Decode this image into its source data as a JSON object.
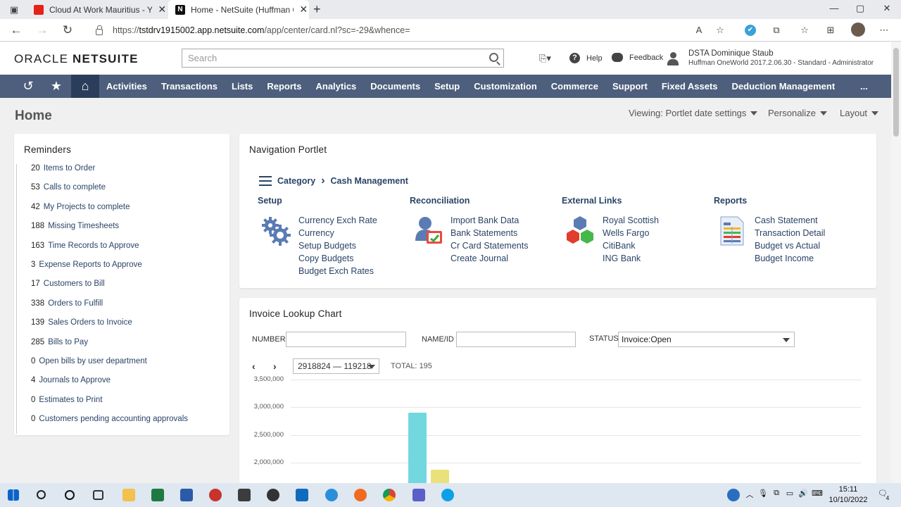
{
  "browser": {
    "tabs": [
      {
        "title": "Cloud At Work Mauritius - YouTube"
      },
      {
        "title": "Home - NetSuite (Huffman OneWorld)"
      }
    ],
    "new_tab": "+",
    "url_prefix": "https://",
    "url_host": "tstdrv1915002.app.netsuite.com",
    "url_path": "/app/center/card.nl?sc=-29&whence="
  },
  "header": {
    "logo_light": "ORACLE ",
    "logo_bold": "NETSUITE",
    "search_placeholder": "Search",
    "help": "Help",
    "feedback": "Feedback",
    "user_name": "DSTA Dominique Staub",
    "user_role": "Huffman OneWorld 2017.2.06.30 - Standard - Administrator"
  },
  "nav": {
    "items": [
      "Activities",
      "Transactions",
      "Lists",
      "Reports",
      "Analytics",
      "Documents",
      "Setup",
      "Customization",
      "Commerce",
      "Support",
      "Fixed Assets",
      "Deduction Management"
    ],
    "more": "..."
  },
  "page": {
    "title": "Home",
    "viewing": "Viewing: Portlet date settings",
    "personalize": "Personalize",
    "layout": "Layout"
  },
  "reminders": {
    "title": "Reminders",
    "items": [
      {
        "count": "20",
        "label": "Items to Order"
      },
      {
        "count": "53",
        "label": "Calls to complete"
      },
      {
        "count": "42",
        "label": "My Projects to complete"
      },
      {
        "count": "188",
        "label": "Missing Timesheets"
      },
      {
        "count": "163",
        "label": "Time Records to Approve"
      },
      {
        "count": "3",
        "label": "Expense Reports to Approve"
      },
      {
        "count": "17",
        "label": "Customers to Bill"
      },
      {
        "count": "338",
        "label": "Orders to Fulfill"
      },
      {
        "count": "139",
        "label": "Sales Orders to Invoice"
      },
      {
        "count": "285",
        "label": "Bills to Pay"
      },
      {
        "count": "0",
        "label": "Open bills by user department"
      },
      {
        "count": "4",
        "label": "Journals to Approve"
      },
      {
        "count": "0",
        "label": "Estimates to Print"
      },
      {
        "count": "0",
        "label": "Customers pending accounting approvals"
      }
    ]
  },
  "navportlet": {
    "title": "Navigation Portlet",
    "crumb_root": "Category",
    "crumb_current": "Cash Management",
    "columns": [
      {
        "title": "Setup",
        "icon": "gears-icon",
        "links": [
          "Currency Exch Rate",
          "Currency",
          "Setup Budgets",
          "Copy Budgets",
          "Budget Exch Rates"
        ]
      },
      {
        "title": "Reconciliation",
        "icon": "reconcile-icon",
        "links": [
          "Import Bank Data",
          "Bank Statements",
          "Cr Card Statements",
          "Create Journal"
        ]
      },
      {
        "title": "External Links",
        "icon": "hexagons-icon",
        "links": [
          "Royal Scottish",
          "Wells Fargo",
          "CitiBank",
          "ING Bank"
        ]
      },
      {
        "title": "Reports",
        "icon": "report-icon",
        "links": [
          "Cash Statement",
          "Transaction Detail",
          "Budget vs Actual",
          "Budget Income"
        ]
      }
    ]
  },
  "invoice": {
    "title": "Invoice Lookup Chart",
    "number_label": "NUMBER",
    "name_label": "NAME/ID",
    "status_label": "STATUS",
    "status_value": "Invoice:Open",
    "range": "2918824 — 119218",
    "total_label": "TOTAL:",
    "total_value": "195",
    "prev": "‹",
    "next": "›"
  },
  "chart_data": {
    "type": "bar",
    "ytick_labels": [
      "3,500,000",
      "3,000,000",
      "2,500,000",
      "2,000,000"
    ],
    "ylim": [
      1850000,
      3500000
    ],
    "bars": [
      {
        "value": 2900000,
        "color": "#73d7e0"
      },
      {
        "value": 1870000,
        "color": "#e9e27a"
      }
    ]
  },
  "taskbar": {
    "time": "15:11",
    "date": "10/10/2022",
    "notifications": "4"
  }
}
